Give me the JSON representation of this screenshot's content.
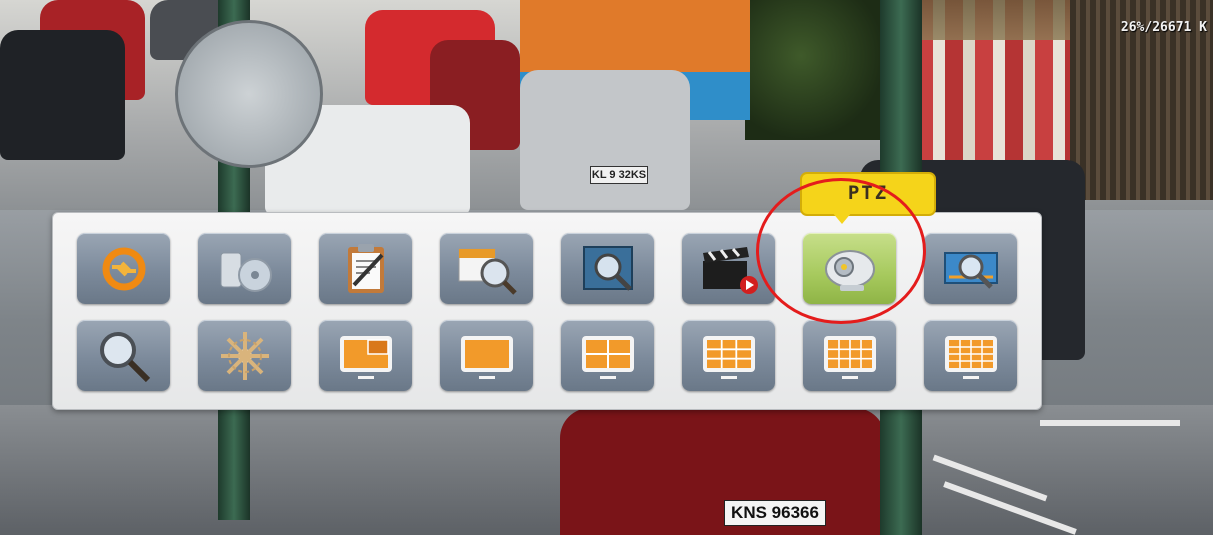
{
  "overlay": {
    "bitrate_counter": "26%/26671 K",
    "plate_near": "KNS 96366",
    "plate_far": "KL 9 32KS"
  },
  "menu": {
    "row1": [
      {
        "name": "recording-control-icon"
      },
      {
        "name": "backup-icon"
      },
      {
        "name": "log-icon"
      },
      {
        "name": "calendar-search-icon"
      },
      {
        "name": "playback-search-icon"
      },
      {
        "name": "video-playback-icon"
      },
      {
        "name": "ptz-camera-icon"
      },
      {
        "name": "screen-search-icon"
      }
    ],
    "row2": [
      {
        "name": "search-icon"
      },
      {
        "name": "settings-icon"
      },
      {
        "name": "pip-layout-icon"
      },
      {
        "name": "single-screen-icon"
      },
      {
        "name": "quad-layout-icon"
      },
      {
        "name": "nine-layout-icon"
      },
      {
        "name": "twelve-layout-icon"
      },
      {
        "name": "sixteen-layout-icon"
      }
    ],
    "tooltip": "PTZ",
    "active_item": "ptz-camera-icon",
    "colors": {
      "tile": "#7c8a9b",
      "active_tile": "#a6c95d",
      "tooltip": "#f5d41a",
      "highlight": "#e41c1c"
    }
  }
}
